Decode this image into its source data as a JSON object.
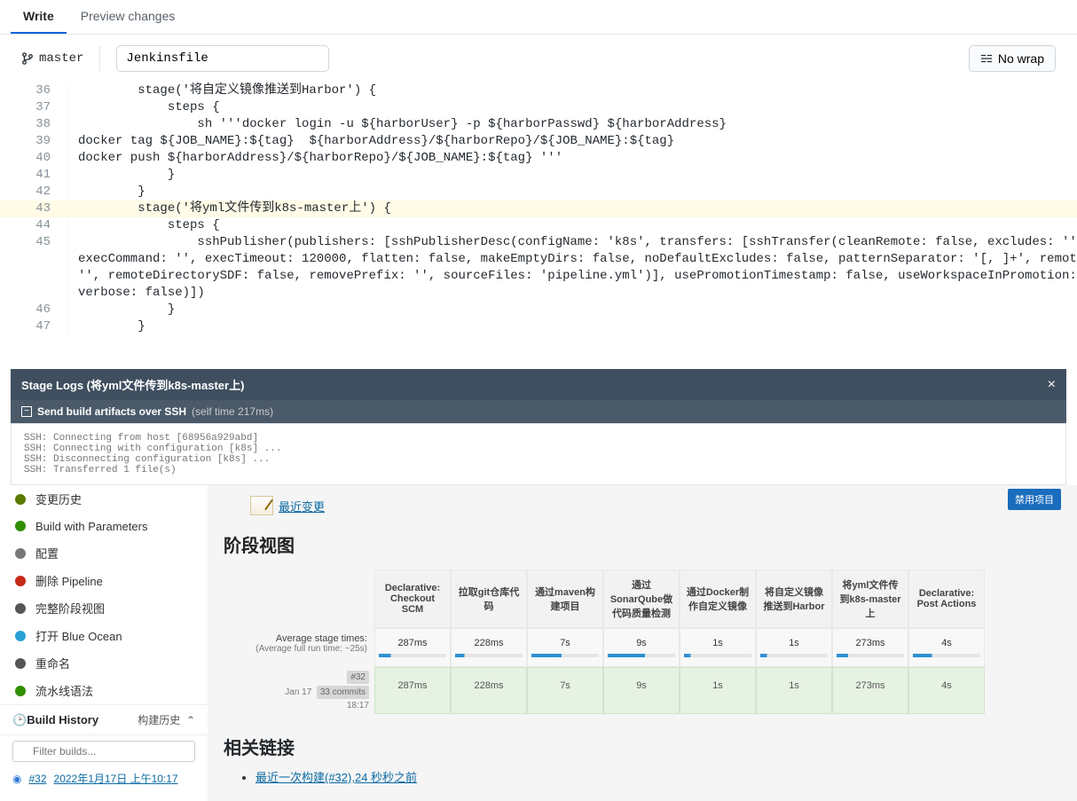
{
  "tabs": {
    "write": "Write",
    "preview": "Preview changes"
  },
  "branch": {
    "name": "master"
  },
  "filename": "Jenkinsfile",
  "wrap_btn": "No wrap",
  "code_lines": [
    {
      "n": "36",
      "t": "        stage('将自定义镜像推送到Harbor') {"
    },
    {
      "n": "37",
      "t": "            steps {"
    },
    {
      "n": "38",
      "t": "                sh '''docker login -u ${harborUser} -p ${harborPasswd} ${harborAddress}"
    },
    {
      "n": "39",
      "t": "docker tag ${JOB_NAME}:${tag}  ${harborAddress}/${harborRepo}/${JOB_NAME}:${tag}"
    },
    {
      "n": "40",
      "t": "docker push ${harborAddress}/${harborRepo}/${JOB_NAME}:${tag} '''"
    },
    {
      "n": "41",
      "t": "            }"
    },
    {
      "n": "42",
      "t": "        }"
    },
    {
      "n": "43",
      "t": "        stage('将yml文件传到k8s-master上') {",
      "hl": true
    },
    {
      "n": "44",
      "t": "            steps {"
    },
    {
      "n": "45",
      "t": "                sshPublisher(publishers: [sshPublisherDesc(configName: 'k8s', transfers: [sshTransfer(cleanRemote: false, excludes: '',"
    },
    {
      "n": "",
      "t": "execCommand: '', execTimeout: 120000, flatten: false, makeEmptyDirs: false, noDefaultExcludes: false, patternSeparator: '[, ]+', remoteDirectory:"
    },
    {
      "n": "",
      "t": "'', remoteDirectorySDF: false, removePrefix: '', sourceFiles: 'pipeline.yml')], usePromotionTimestamp: false, useWorkspaceInPromotion: false,"
    },
    {
      "n": "",
      "t": "verbose: false)])"
    },
    {
      "n": "46",
      "t": "            }"
    },
    {
      "n": "47",
      "t": "        }"
    }
  ],
  "stage_logs": {
    "title": "Stage Logs (将yml文件传到k8s-master上)",
    "task_title": "Send build artifacts over SSH",
    "task_time": "(self time 217ms)",
    "lines": [
      "SSH: Connecting from host [68956a929abd]",
      "SSH: Connecting with configuration [k8s] ...",
      "SSH: Disconnecting configuration [k8s] ...",
      "SSH: Transferred 1 file(s)"
    ]
  },
  "sidebar": {
    "items": [
      {
        "label": "变更历史",
        "color": "#5a7a00"
      },
      {
        "label": "Build with Parameters",
        "color": "#2f8f00"
      },
      {
        "label": "配置",
        "color": "#777"
      },
      {
        "label": "删除 Pipeline",
        "color": "#c52917"
      },
      {
        "label": "完整阶段视图",
        "color": "#555"
      },
      {
        "label": "打开 Blue Ocean",
        "color": "#2aa1d4"
      },
      {
        "label": "重命名",
        "color": "#555"
      },
      {
        "label": "流水线语法",
        "color": "#2f8f00"
      }
    ],
    "build_history": "Build History",
    "build_history_sub": "构建历史",
    "filter_placeholder": "Filter builds...",
    "build": {
      "num": "#32",
      "date": "2022年1月17日 上午10:17"
    }
  },
  "main": {
    "disable_btn": "禁用项目",
    "recent_changes": "最近变更",
    "stage_view_title": "阶段视图",
    "avg_label1": "Average stage times:",
    "avg_label2": "(Average full run time: ~25s)",
    "run_date": "Jan 17",
    "run_time": "18:17",
    "run_badge": "33 commits",
    "related_links": "相关链接",
    "last_build": "最近一次构建(#32),24 秒秒之前"
  },
  "chart_data": {
    "type": "table",
    "title": "阶段视图",
    "columns": [
      "Declarative: Checkout SCM",
      "拉取git仓库代码",
      "通过maven构建项目",
      "通过SonarQube做代码质量检测",
      "通过Docker制作自定义镜像",
      "将自定义镜像推送到Harbor",
      "将yml文件传到k8s-master上",
      "Declarative: Post Actions"
    ],
    "rows": [
      {
        "label": "Average stage times:",
        "values": [
          "287ms",
          "228ms",
          "7s",
          "9s",
          "1s",
          "1s",
          "273ms",
          "4s"
        ]
      },
      {
        "label": "#32 Jan 17 18:17",
        "values": [
          "287ms",
          "228ms",
          "7s",
          "9s",
          "1s",
          "1s",
          "273ms",
          "4s"
        ]
      }
    ],
    "avg_full_run": "~25s"
  }
}
